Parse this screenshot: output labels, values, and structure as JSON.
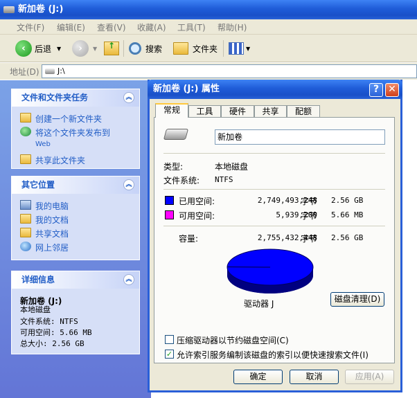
{
  "window": {
    "title": "新加卷 (J:)"
  },
  "menu": [
    "文件(F)",
    "编辑(E)",
    "查看(V)",
    "收藏(A)",
    "工具(T)",
    "帮助(H)"
  ],
  "toolbar": {
    "back": "后退",
    "search": "搜索",
    "folders": "文件夹"
  },
  "address": {
    "label": "地址(D)",
    "value": "J:\\"
  },
  "tasks": {
    "header": "文件和文件夹任务",
    "items": [
      "创建一个新文件夹",
      "将这个文件夹发布到",
      "Web",
      "共享此文件夹"
    ]
  },
  "places": {
    "header": "其它位置",
    "items": [
      "我的电脑",
      "我的文档",
      "共享文档",
      "网上邻居"
    ]
  },
  "details": {
    "header": "详细信息",
    "name": "新加卷 (J:)",
    "type": "本地磁盘",
    "fs": "文件系统: NTFS",
    "free": "可用空间: 5.66 MB",
    "total": "总大小: 2.56 GB"
  },
  "dialog": {
    "title": "新加卷 (J:) 属性",
    "help": "?",
    "close": "✕",
    "tabs": [
      "常规",
      "工具",
      "硬件",
      "共享",
      "配额"
    ],
    "volume_name": "新加卷",
    "type_label": "类型:",
    "type_value": "本地磁盘",
    "fs_label": "文件系统:",
    "fs_value": "NTFS",
    "used_label": "已用空间:",
    "used_bytes": "2,749,493,248",
    "used_unit": "字节",
    "used_size": "2.56 GB",
    "free_label": "可用空间:",
    "free_bytes": "5,939,200",
    "free_unit": "字节",
    "free_size": "5.66 MB",
    "cap_label": "容量:",
    "cap_bytes": "2,755,432,448",
    "cap_unit": "字节",
    "cap_size": "2.56 GB",
    "drive_label": "驱动器 J",
    "cleanup": "磁盘清理(D)",
    "compress": "压缩驱动器以节约磁盘空间(C)",
    "index": "允许索引服务编制该磁盘的索引以便快速搜索文件(I)",
    "ok": "确定",
    "cancel": "取消",
    "apply": "应用(A)",
    "used_color": "#0000ff",
    "free_color": "#ff00ff",
    "compress_checked": false,
    "index_checked": true,
    "used_fraction": 0.9978
  }
}
